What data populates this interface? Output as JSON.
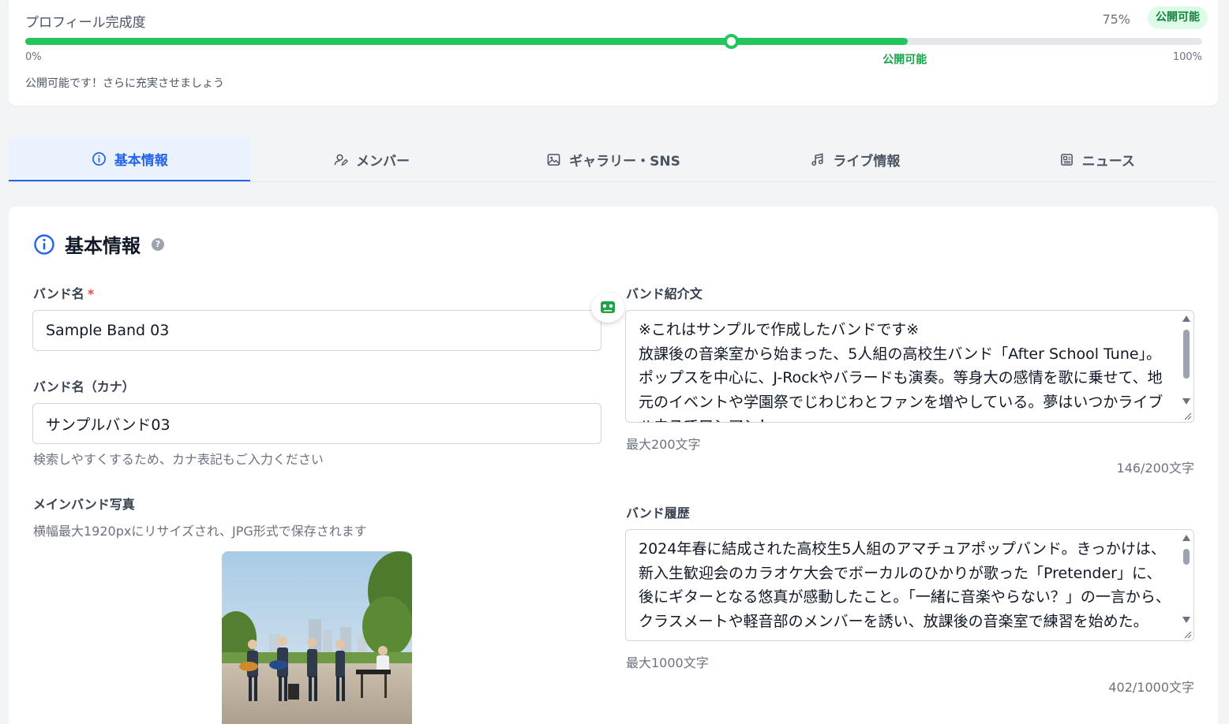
{
  "progress": {
    "title": "プロフィール完成度",
    "percent_label": "75%",
    "badge": "公開可能",
    "value": 0.75,
    "marker_value": 0.6,
    "tick_start": "0%",
    "tick_publish": "公開可能",
    "tick_end": "100%",
    "note": "公開可能です！さらに充実させましょう",
    "colors": {
      "fill": "#22c55e",
      "badge_bg": "#dcfce7",
      "badge_text": "#15803d"
    }
  },
  "tabs": [
    {
      "label": "基本情報",
      "icon": "info-icon",
      "active": true
    },
    {
      "label": "メンバー",
      "icon": "user-edit-icon",
      "active": false
    },
    {
      "label": "ギャラリー・SNS",
      "icon": "image-icon",
      "active": false
    },
    {
      "label": "ライブ情報",
      "icon": "music-note-icon",
      "active": false
    },
    {
      "label": "ニュース",
      "icon": "newspaper-icon",
      "active": false
    }
  ],
  "section": {
    "title": "基本情報",
    "icon": "info-icon",
    "help": "?"
  },
  "form": {
    "band_name": {
      "label": "バンド名",
      "required_mark": "*",
      "value": "Sample Band 03"
    },
    "band_name_kana": {
      "label": "バンド名（カナ）",
      "value": "サンプルバンド03",
      "hint": "検索しやすくするため、カナ表記もご入力ください"
    },
    "main_photo": {
      "label": "メインバンド写真",
      "hint": "横幅最大1920pxにリサイズされ、JPG形式で保存されます"
    },
    "intro": {
      "label": "バンド紹介文",
      "value": "※これはサンプルで作成したバンドです※\n放課後の音楽室から始まった、5人組の高校生バンド「After School Tune」。ポップスを中心に、J-Rockやバラードも演奏。等身大の感情を歌に乗せて、地元のイベントや学園祭でじわじわとファンを増やしている。夢はいつかライブハウスでワンマン！",
      "max_hint": "最大200文字",
      "counter": "146/200文字"
    },
    "history": {
      "label": "バンド履歴",
      "value": "2024年春に結成された高校生5人組のアマチュアポップバンド。きっかけは、新入生歓迎会のカラオケ大会でボーカルのひかりが歌った「Pretender」に、後にギターとなる悠真が感動したこと。「一緒に音楽やらない？」の一言から、クラスメートや軽音部のメンバーを誘い、放課後の音楽室で練習を始めた。",
      "max_hint": "最大1000文字",
      "counter": "402/1000文字"
    }
  },
  "colors": {
    "accent": "#2563eb",
    "success": "#22c55e"
  }
}
